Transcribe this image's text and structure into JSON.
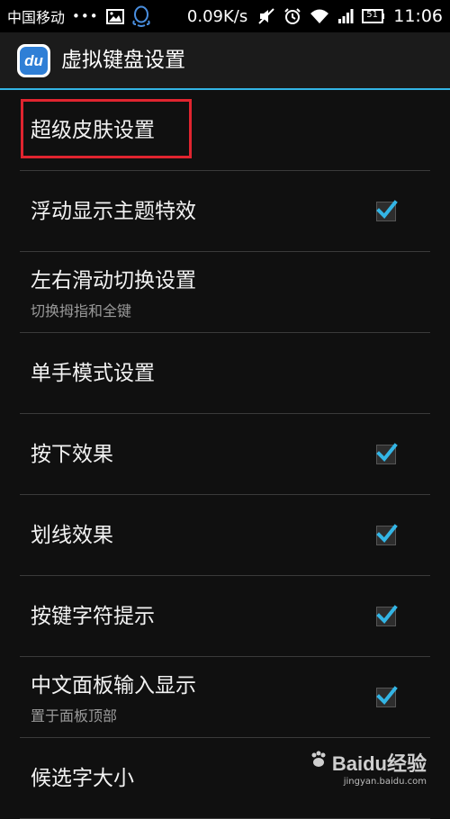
{
  "status_bar": {
    "carrier": "中国移动",
    "dots": "•••",
    "speed": "0.09K/s",
    "battery": "51",
    "time": "11:06",
    "icons": [
      "image-icon",
      "qq-icon",
      "mute-icon",
      "alarm-icon",
      "wifi-icon",
      "signal-icon",
      "battery-icon"
    ]
  },
  "action_bar": {
    "app_icon_text": "du",
    "title": "虚拟键盘设置"
  },
  "settings": [
    {
      "title": "超级皮肤设置",
      "subtitle": "",
      "checked": null
    },
    {
      "title": "浮动显示主题特效",
      "subtitle": "",
      "checked": true
    },
    {
      "title": "左右滑动切换设置",
      "subtitle": "切换拇指和全键",
      "checked": null
    },
    {
      "title": "单手模式设置",
      "subtitle": "",
      "checked": null
    },
    {
      "title": "按下效果",
      "subtitle": "",
      "checked": true
    },
    {
      "title": "划线效果",
      "subtitle": "",
      "checked": true
    },
    {
      "title": "按键字符提示",
      "subtitle": "",
      "checked": true
    },
    {
      "title": "中文面板输入显示",
      "subtitle": "置于面板顶部",
      "checked": true
    },
    {
      "title": "候选字大小",
      "subtitle": "",
      "checked": null
    }
  ],
  "colors": {
    "accent": "#33b5e5",
    "highlight": "#e0242f",
    "background": "#101010"
  },
  "watermark": {
    "brand": "Baidu经验",
    "url": "jingyan.baidu.com"
  }
}
